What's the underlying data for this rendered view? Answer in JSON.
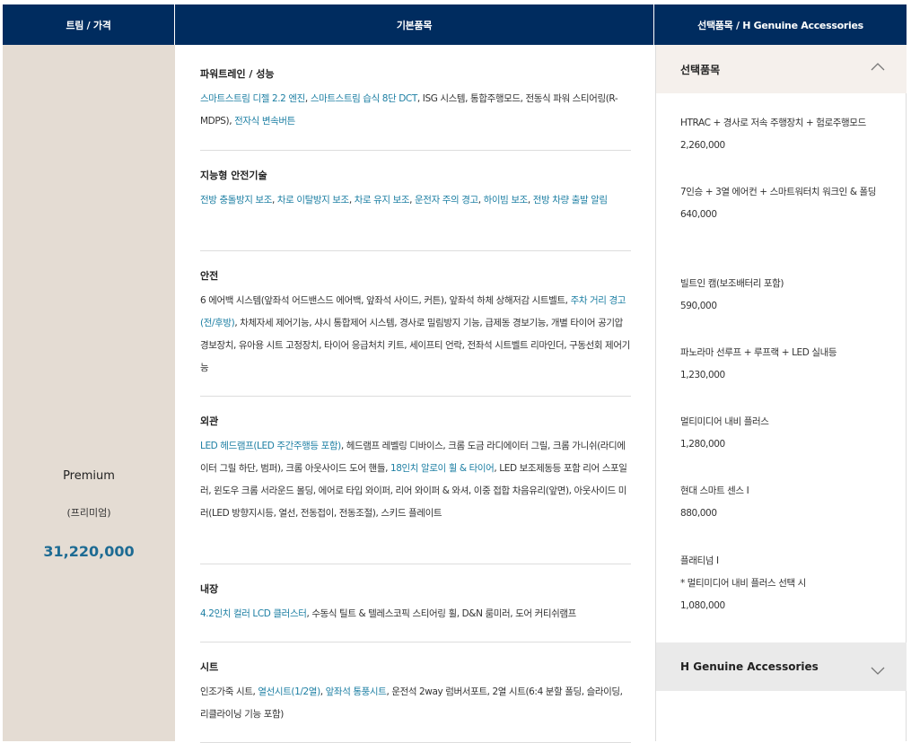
{
  "header": {
    "col_trim": "트림 / 가격",
    "col_basic": "기본품목",
    "col_option": "선택품목 / H Genuine Accessories"
  },
  "trim": {
    "name": "Premium",
    "sub": "(프리미엄)",
    "price": "31,220,000"
  },
  "groups": [
    {
      "title": "파워트레인 / 성능",
      "segments": [
        {
          "t": "스마트스트림 디젤 2.2 엔진",
          "hl": true
        },
        {
          "t": ", ",
          "hl": false
        },
        {
          "t": "스마트스트림 습식 8단 DCT",
          "hl": true
        },
        {
          "t": ", ISG 시스템, 통합주행모드, 전동식 파워 스티어링(R-MDPS), ",
          "hl": false
        },
        {
          "t": "전자식 변속버튼",
          "hl": true
        }
      ]
    },
    {
      "title": "지능형 안전기술",
      "segments": [
        {
          "t": "전방 충돌방지 보조",
          "hl": true
        },
        {
          "t": ", ",
          "hl": false
        },
        {
          "t": "차로 이탈방지 보조",
          "hl": true
        },
        {
          "t": ", ",
          "hl": false
        },
        {
          "t": "차로 유지 보조",
          "hl": true
        },
        {
          "t": ", ",
          "hl": false
        },
        {
          "t": "운전자 주의 경고",
          "hl": true
        },
        {
          "t": ", ",
          "hl": false
        },
        {
          "t": "하이빔 보조",
          "hl": true
        },
        {
          "t": ", ",
          "hl": false
        },
        {
          "t": "전방 차량 출발 알림",
          "hl": true
        }
      ]
    },
    {
      "title": "안전",
      "segments": [
        {
          "t": "6 에어백 시스템(앞좌석 어드밴스드 에어백, 앞좌석 사이드, 커튼), 앞좌석 하체 상해저감 시트벨트, ",
          "hl": false
        },
        {
          "t": "주차 거리 경고(전/후방)",
          "hl": true
        },
        {
          "t": ", 차체자세 제어기능, 샤시 통합제어 시스템, 경사로 밀림방지 기능, 급제동 경보기능, 개별 타이어 공기압 경보장치, 유아용 시트 고정장치, 타이어 응급처치 키트, 세이프티 언락, 전좌석 시트벨트 리마인더, 구동선회 제어기능",
          "hl": false
        }
      ]
    },
    {
      "title": "외관",
      "segments": [
        {
          "t": "LED 헤드램프(LED 주간주행등 포함)",
          "hl": true
        },
        {
          "t": ", 헤드램프 레벨링 디바이스, 크롬 도금 라디에이터 그릴, 크롬 가니쉬(라디에이터 그릴 하단, 범퍼), 크롬 아웃사이드 도어 핸들, ",
          "hl": false
        },
        {
          "t": "18인치 알로이 휠 & 타이어",
          "hl": true
        },
        {
          "t": ", LED 보조제동등 포함 리어 스포일러, 윈도우 크롬 서라운드 몰딩, 에어로 타입 와이퍼, 리어 와이퍼 & 와셔, 이중 접합 차음유리(앞면), 아웃사이드 미러(LED 방향지시등, 열선, 전동접이, 전동조절), 스키드 플레이트",
          "hl": false
        }
      ]
    },
    {
      "title": "내장",
      "segments": [
        {
          "t": "4.2인치 컬러 LCD 클러스터",
          "hl": true
        },
        {
          "t": ", 수동식 틸트 & 텔레스코픽 스티어링 휠, D&N 룸미러, 도어 커티쉬램프",
          "hl": false
        }
      ]
    },
    {
      "title": "시트",
      "segments": [
        {
          "t": "인조가죽 시트, ",
          "hl": false
        },
        {
          "t": "열선시트(1/2열)",
          "hl": true
        },
        {
          "t": ", ",
          "hl": false
        },
        {
          "t": "앞좌석 통풍시트",
          "hl": true
        },
        {
          "t": ", 운전석 2way 럼버서포트, 2열 시트(6:4 분할 폴딩, 슬라이딩, 리클라이닝 기능 포함)",
          "hl": false
        }
      ]
    }
  ],
  "options_panel": {
    "title": "선택품목",
    "items": [
      {
        "name": "HTRAC + 경사로 저속 주행장치 + 험로주행모드",
        "price": "2,260,000"
      },
      {
        "name": "7인승 + 3열 에어컨 + 스마트워터치 워크인 & 폴딩",
        "price": "640,000"
      },
      {
        "name": "빌트인 캠(보조배터리 포함)",
        "price": "590,000"
      },
      {
        "name": "파노라마 선루프 + 루프랙 + LED 실내등",
        "price": "1,230,000"
      },
      {
        "name": "멀티미디어 내비 플러스",
        "price": "1,280,000"
      },
      {
        "name": "현대 스마트 센스 Ⅰ",
        "price": "880,000"
      },
      {
        "name": "플래티넘 Ⅰ",
        "note": "* 멀티미디어 내비 플러스 선택 시",
        "price": "1,080,000"
      }
    ]
  },
  "accessories_panel": {
    "title": "H Genuine Accessories"
  },
  "icons": {
    "options_toggle": "chevron-up-icon",
    "accessories_toggle": "chevron-down-icon"
  },
  "colors": {
    "header_bg": "#002c5f",
    "trim_bg": "#e4dcd3",
    "highlight": "#1d7fa3",
    "price": "#1d6b93"
  }
}
